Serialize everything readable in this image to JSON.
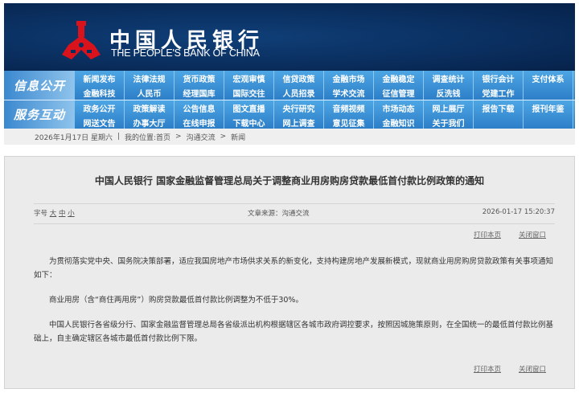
{
  "header": {
    "bank_name_cn": "中国人民银行",
    "bank_name_en": "THE PEOPLE'S BANK OF CHINA"
  },
  "nav": {
    "block1_label": "信息公开",
    "block1_rows": [
      [
        "新闻发布",
        "法律法规",
        "货币政策",
        "宏观审慎",
        "信贷政策",
        "金融市场",
        "金融稳定",
        "调查统计",
        "银行会计",
        "支付体系"
      ],
      [
        "金融科技",
        "人民币",
        "经理国库",
        "国际交往",
        "人员招录",
        "学术交流",
        "征信管理",
        "反洗钱",
        "党建工作"
      ]
    ],
    "block2_label": "服务互动",
    "block2_rows": [
      [
        "政务公开",
        "政策解读",
        "公告信息",
        "图文直播",
        "央行研究",
        "音频视频",
        "市场动态",
        "网上展厅",
        "报告下载",
        "报刊年鉴"
      ],
      [
        "网送文告",
        "办事大厅",
        "在线申报",
        "下载中心",
        "网上调查",
        "意见征集",
        "金融知识",
        "关于我们"
      ]
    ]
  },
  "breadcrumb": {
    "date": "2026年1月17日 星期六",
    "sep": "|",
    "location": "我的位置:首页",
    "arrow": ">",
    "items": [
      "沟通交流",
      "新闻"
    ]
  },
  "article": {
    "title": "中国人民银行 国家金融监督管理总局关于调整商业用房购房贷款最低首付款比例政策的通知",
    "font_label": "字号",
    "font_sizes": [
      "大",
      "中",
      "小"
    ],
    "source": "文章来源：沟通交流",
    "datetime": "2026-01-17 15:20:37",
    "print": "打印本页",
    "close": "关闭窗口",
    "paragraphs": [
      "为贯彻落实党中央、国务院决策部署，适应我国房地产市场供求关系的新变化，支持构建房地产发展新模式，现就商业用房购房贷款政策有关事项通知如下：",
      "商业用房（含“商住两用房”）购房贷款最低首付款比例调整为不低于30%。",
      "中国人民银行各省级分行、国家金融监督管理总局各省级派出机构根据辖区各城市政府调控要求，按照因城施策原则，在全国统一的最低首付款比例基础上，自主确定辖区各城市最低首付款比例下限。"
    ]
  }
}
